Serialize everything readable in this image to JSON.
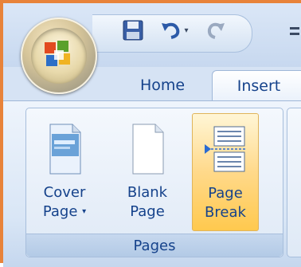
{
  "tabs": {
    "home": "Home",
    "insert": "Insert"
  },
  "group": {
    "label": "Pages"
  },
  "buttons": {
    "cover_page": {
      "line1": "Cover",
      "line2": "Page",
      "caret": "▾"
    },
    "blank_page": {
      "line1": "Blank",
      "line2": "Page"
    },
    "page_break": {
      "line1": "Page",
      "line2": "Break"
    }
  },
  "colors": {
    "accent_border": "#e8833a",
    "tab_text": "#15428b",
    "active_button": "#ffc94e"
  },
  "icons": {
    "office": "office-orb-icon",
    "save": "save-icon",
    "undo": "undo-icon",
    "redo": "redo-icon"
  }
}
